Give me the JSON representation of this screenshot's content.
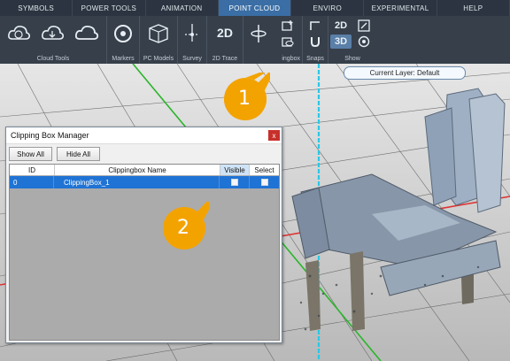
{
  "tabs": [
    {
      "label": "SYMBOLS"
    },
    {
      "label": "POWER TOOLS"
    },
    {
      "label": "ANIMATION"
    },
    {
      "label": "POINT CLOUD",
      "active": true
    },
    {
      "label": "ENVIRO"
    },
    {
      "label": "EXPERIMENTAL"
    },
    {
      "label": "HELP"
    }
  ],
  "ribbon": {
    "groups": {
      "cloud_tools": "Cloud Tools",
      "markers": "Markers",
      "pc_models": "PC Models",
      "survey": "Survey",
      "trace": "2D Trace",
      "clip_partial": "ingbox",
      "snaps": "Snaps",
      "show": "Show"
    },
    "buttons": {
      "trace_2d": "2D",
      "show_2d": "2D",
      "show_3d": "3D"
    },
    "icons": [
      "cloud-load-icon",
      "cloud-save-icon",
      "cloud-icon",
      "marker-icon",
      "pc-model-icon",
      "survey-icon",
      "trace-icon",
      "clipping-box-add-icon",
      "clipping-box-manager-icon",
      "snap-icon",
      "magnet-icon",
      "target-icon",
      "show-window-icon"
    ]
  },
  "current_layer": "Current Layer: Default",
  "callouts": [
    "1",
    "2"
  ],
  "dialog": {
    "title": "Clipping Box Manager",
    "close": "x",
    "show_all": "Show All",
    "hide_all": "Hide All",
    "columns": [
      "ID",
      "Clippingbox Name",
      "Visible",
      "Select"
    ],
    "rows": [
      {
        "id": "0",
        "name": "ClippingBox_1",
        "visible": true,
        "select": true
      }
    ]
  },
  "colors": {
    "ribbon": "#363f4a",
    "tab_active": "#3a6ea5",
    "row_selected": "#1f73d4",
    "callout": "#f3a300",
    "close_button": "#c7302b"
  }
}
